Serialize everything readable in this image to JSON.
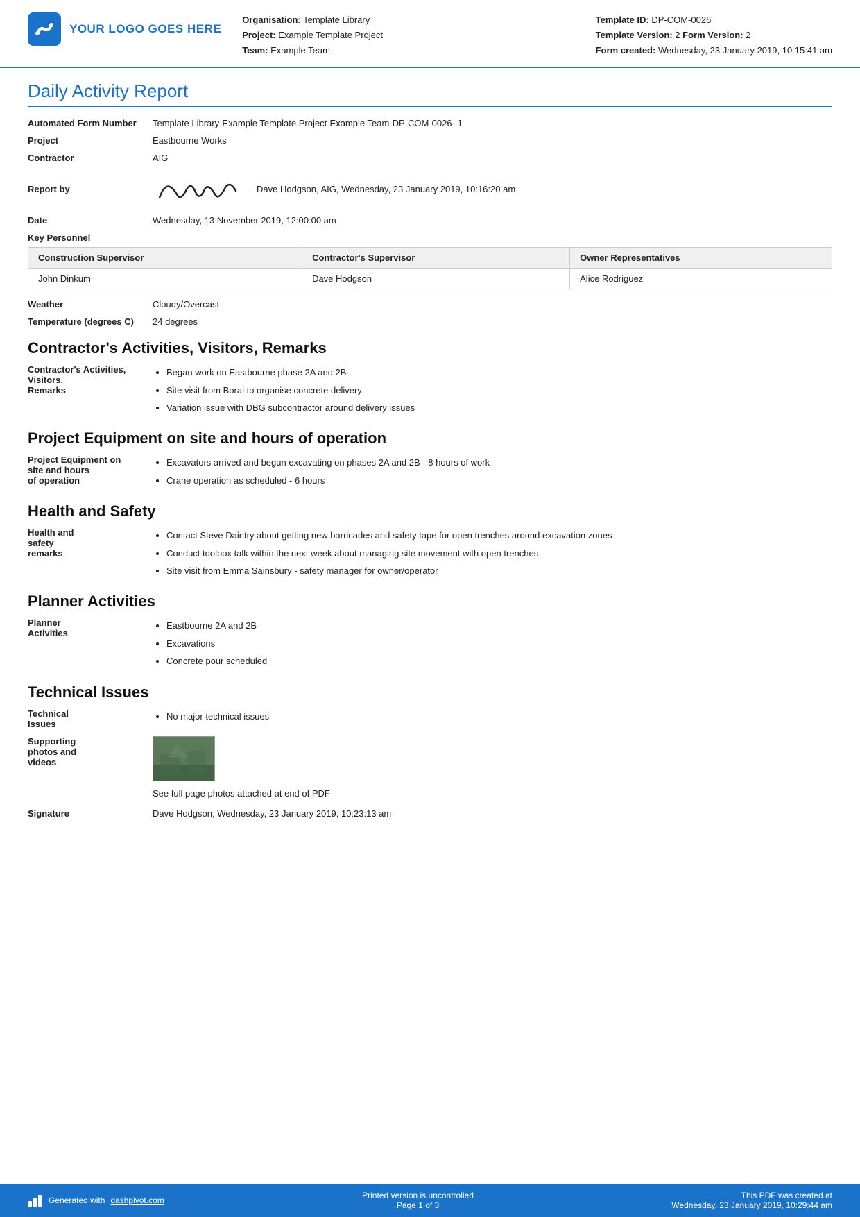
{
  "header": {
    "logo_text": "YOUR LOGO GOES HERE",
    "org_label": "Organisation:",
    "org_value": "Template Library",
    "project_label": "Project:",
    "project_value": "Example Template Project",
    "team_label": "Team:",
    "team_value": "Example Team",
    "template_id_label": "Template ID:",
    "template_id_value": "DP-COM-0026",
    "template_version_label": "Template Version:",
    "template_version_value": "2",
    "form_version_label": "Form Version:",
    "form_version_value": "2",
    "form_created_label": "Form created:",
    "form_created_value": "Wednesday, 23 January 2019, 10:15:41 am"
  },
  "report": {
    "title": "Daily Activity Report",
    "form_number_label": "Automated Form Number",
    "form_number_value": "Template Library-Example Template Project-Example Team-DP-COM-0026   -1",
    "project_label": "Project",
    "project_value": "Eastbourne Works",
    "contractor_label": "Contractor",
    "contractor_value": "AIG",
    "report_by_label": "Report by",
    "report_by_value": "Dave Hodgson, AIG, Wednesday, 23 January 2019, 10:16:20 am",
    "date_label": "Date",
    "date_value": "Wednesday, 13 November 2019, 12:00:00 am"
  },
  "key_personnel": {
    "label": "Key Personnel",
    "columns": [
      "Construction Supervisor",
      "Contractor's Supervisor",
      "Owner Representatives"
    ],
    "rows": [
      [
        "John Dinkum",
        "Dave Hodgson",
        "Alice Rodriguez"
      ]
    ]
  },
  "weather": {
    "label": "Weather",
    "value": "Cloudy/Overcast"
  },
  "temperature": {
    "label": "Temperature (degrees C)",
    "value": "24 degrees"
  },
  "contractors_activities": {
    "title": "Contractor's Activities, Visitors, Remarks",
    "label": "Contractor's Activities, Visitors, Remarks",
    "items": [
      "Began work on Eastbourne phase 2A and 2B",
      "Site visit from Boral to organise concrete delivery",
      "Variation issue with DBG subcontractor around delivery issues"
    ]
  },
  "project_equipment": {
    "title": "Project Equipment on site and hours of operation",
    "label": "Project Equipment on site and hours of operation",
    "items": [
      "Excavators arrived and begun excavating on phases 2A and 2B - 8 hours of work",
      "Crane operation as scheduled - 6 hours"
    ]
  },
  "health_safety": {
    "title": "Health and Safety",
    "label": "Health and safety remarks",
    "items": [
      "Contact Steve Daintry about getting new barricades and safety tape for open trenches around excavation zones",
      "Conduct toolbox talk within the next week about managing site movement with open trenches",
      "Site visit from Emma Sainsbury - safety manager for owner/operator"
    ]
  },
  "planner_activities": {
    "title": "Planner Activities",
    "label": "Planner Activities",
    "items": [
      "Eastbourne 2A and 2B",
      "Excavations",
      "Concrete pour scheduled"
    ]
  },
  "technical_issues": {
    "title": "Technical Issues",
    "label": "Technical Issues",
    "items": [
      "No major technical issues"
    ],
    "supporting_label": "Supporting photos and videos",
    "photo_caption": "See full page photos attached at end of PDF"
  },
  "signature": {
    "label": "Signature",
    "value": "Dave Hodgson, Wednesday, 23 January 2019, 10:23:13 am"
  },
  "footer": {
    "generated_text": "Generated with",
    "link_text": "dashpivot.com",
    "center_text": "Printed version is uncontrolled",
    "page_text": "Page 1 of 3",
    "right_text": "This PDF was created at",
    "right_date": "Wednesday, 23 January 2019, 10:29:44 am"
  }
}
